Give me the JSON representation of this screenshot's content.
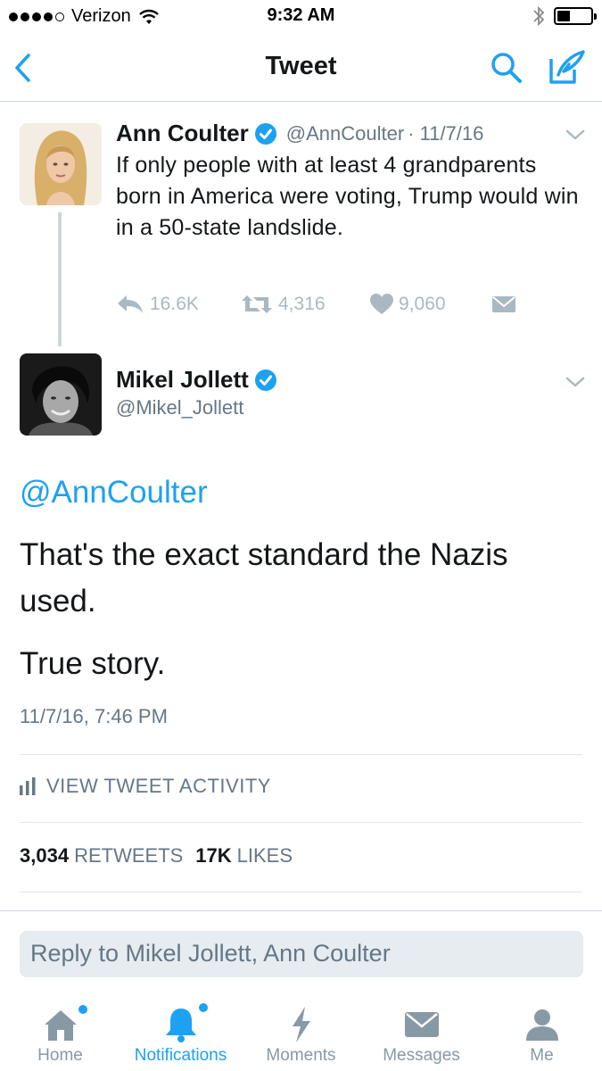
{
  "status_bar": {
    "carrier": "Verizon",
    "time": "9:32 AM"
  },
  "nav": {
    "title": "Tweet"
  },
  "parent_tweet": {
    "name": "Ann Coulter",
    "handle": "@AnnCoulter",
    "date": "· 11/7/16",
    "text": "If only people with at least 4 grandparents born in America were voting, Trump would win in a 50-state landslide.",
    "replies": "16.6K",
    "retweets": "4,316",
    "likes": "9,060"
  },
  "main_tweet": {
    "name": "Mikel Jollett",
    "handle": "@Mikel_Jollett",
    "mention": "@AnnCoulter",
    "paragraph1": "That's the exact standard the Nazis used.",
    "paragraph2": "True story.",
    "timestamp": "11/7/16, 7:46 PM",
    "activity_label": "VIEW TWEET ACTIVITY",
    "retweet_count": "3,034",
    "retweet_label": "RETWEETS",
    "like_count": "17K",
    "like_label": "LIKES"
  },
  "reply": {
    "placeholder": "Reply to Mikel Jollett, Ann Coulter"
  },
  "tabs": [
    {
      "label": "Home",
      "icon": "home-icon"
    },
    {
      "label": "Notifications",
      "icon": "bell-icon"
    },
    {
      "label": "Moments",
      "icon": "lightning-icon"
    },
    {
      "label": "Messages",
      "icon": "envelope-icon"
    },
    {
      "label": "Me",
      "icon": "person-icon"
    }
  ],
  "colors": {
    "accent": "#1da1f2",
    "muted": "#657786",
    "icon_gray": "#aab8c2",
    "text": "#14171a"
  }
}
